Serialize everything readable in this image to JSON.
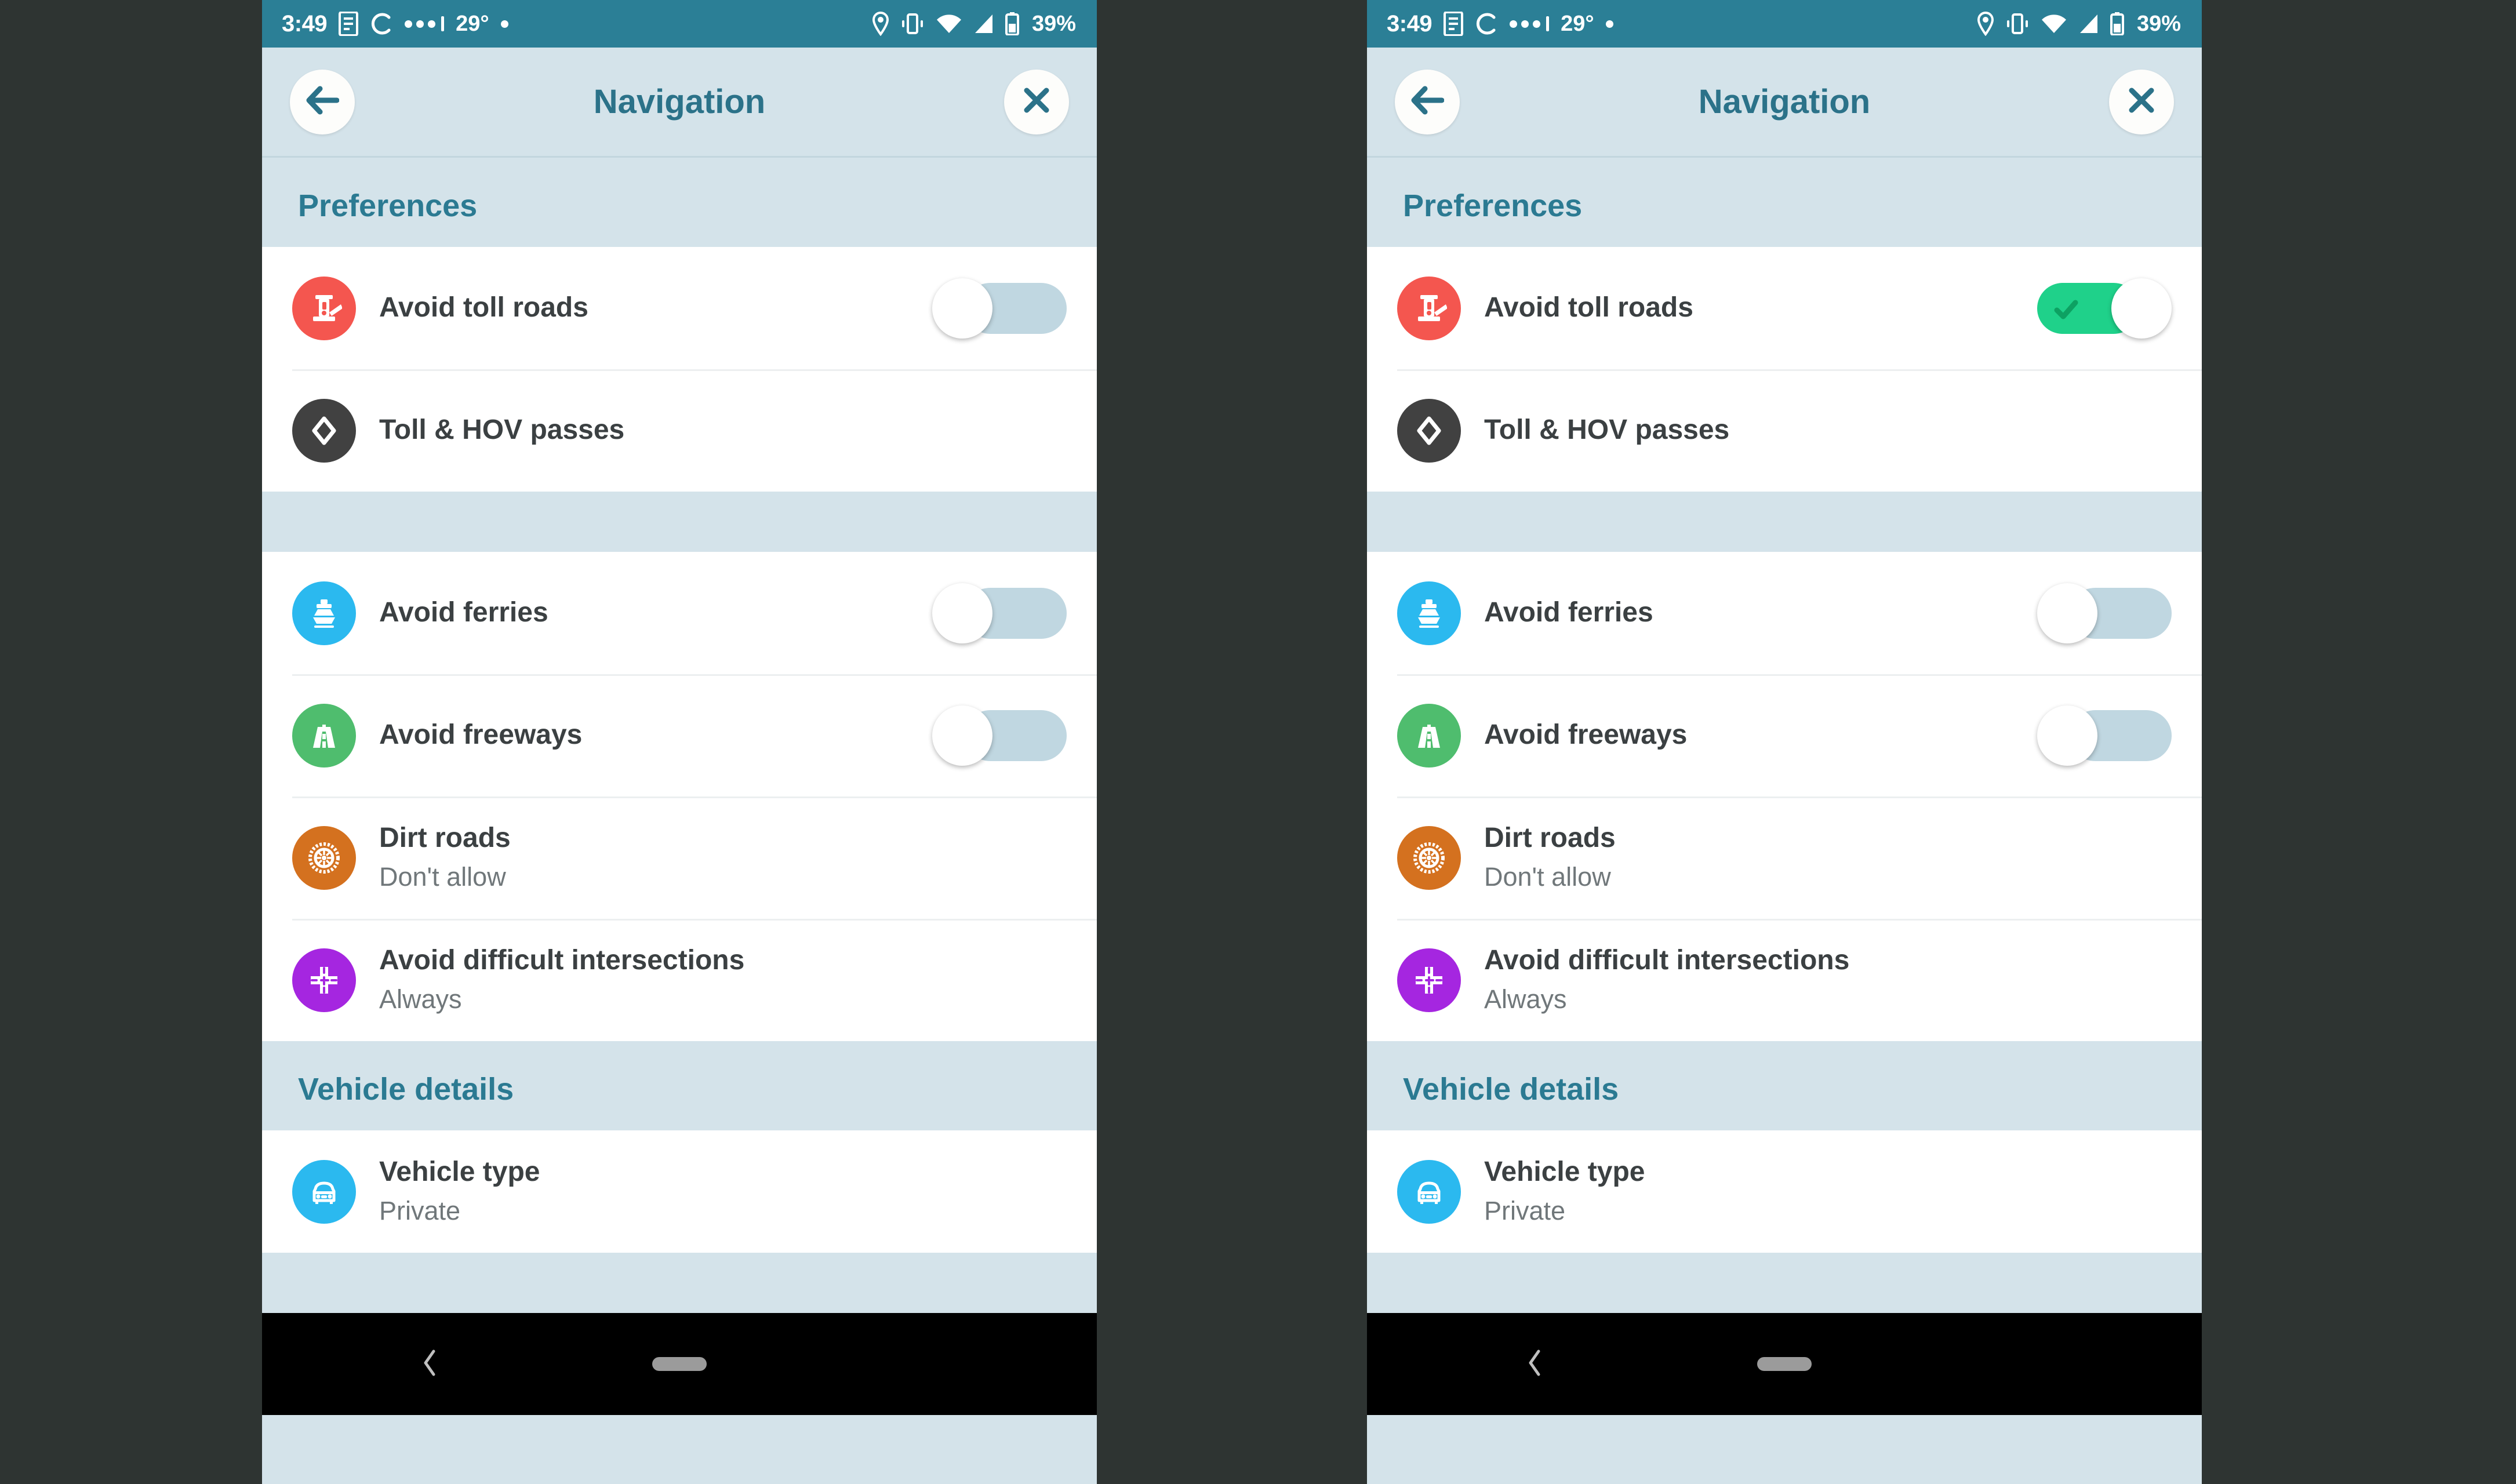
{
  "statusbar": {
    "time": "3:49",
    "temperature": "29°",
    "battery": "39%",
    "icons_left": [
      "document-icon",
      "sync-icon",
      "more-dots-icon",
      "small-dot-icon"
    ],
    "icons_right": [
      "location-pin-icon",
      "vibrate-icon",
      "wifi-icon",
      "cellular-signal-icon",
      "battery-icon"
    ],
    "bg": "#2b7f96"
  },
  "header": {
    "title": "Navigation",
    "back_icon": "back-arrow-icon",
    "close_icon": "close-icon",
    "accent": "#2b7289"
  },
  "sections": [
    {
      "id": "preferences",
      "title": "Preferences"
    },
    {
      "id": "vehicle",
      "title": "Vehicle details"
    }
  ],
  "rows": {
    "avoid_toll_roads": {
      "title": "Avoid toll roads",
      "icon": "toll-booth-icon",
      "icon_color": "#f4564f"
    },
    "toll_hov_passes": {
      "title": "Toll & HOV passes",
      "icon": "hov-diamond-icon",
      "icon_color": "#414141"
    },
    "avoid_ferries": {
      "title": "Avoid ferries",
      "icon": "ferry-icon",
      "icon_color": "#2bb9ef"
    },
    "avoid_freeways": {
      "title": "Avoid freeways",
      "icon": "freeway-icon",
      "icon_color": "#4fbd6e"
    },
    "dirt_roads": {
      "title": "Dirt roads",
      "subtitle": "Don't allow",
      "icon": "tire-icon",
      "icon_color": "#d4711f"
    },
    "avoid_difficult_intersections": {
      "title": "Avoid difficult intersections",
      "subtitle": "Always",
      "icon": "intersection-icon",
      "icon_color": "#a526e0"
    },
    "vehicle_type": {
      "title": "Vehicle type",
      "subtitle": "Private",
      "icon": "car-icon",
      "icon_color": "#2bb9ef"
    }
  },
  "toggles": {
    "off_color": "#c0d7e1",
    "on_color": "#1fd18a",
    "left_panel": {
      "avoid_toll_roads": "off",
      "avoid_ferries": "off",
      "avoid_freeways": "off"
    },
    "right_panel": {
      "avoid_toll_roads": "on",
      "avoid_ferries": "off",
      "avoid_freeways": "off"
    }
  },
  "navbar": {
    "back_icon": "nav-back-chevron-icon",
    "home_icon": "nav-home-pill-icon"
  }
}
